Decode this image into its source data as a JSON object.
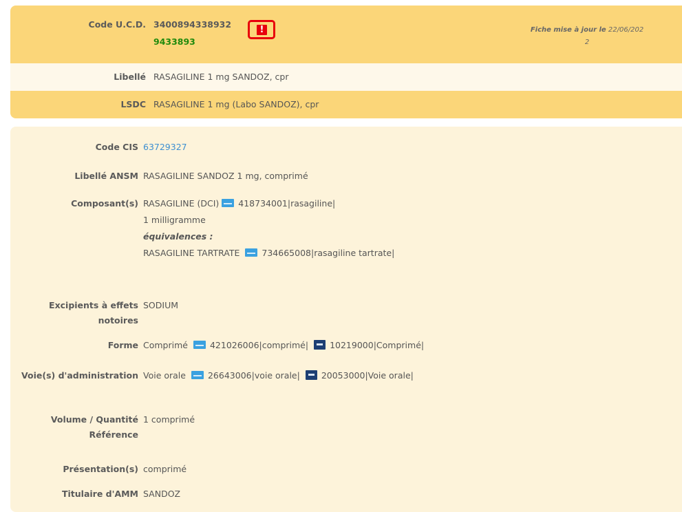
{
  "header": {
    "ucd_label": "Code U.C.D.",
    "ucd_value": "3400894338932",
    "ucd_sub": "9433893",
    "alert_icon": "!",
    "updated_label": "Fiche mise à jour le",
    "updated_date": "22/06/202",
    "updated_date_wrap": "2",
    "libelle_label": "Libellé",
    "libelle_value": "RASAGILINE 1 mg SANDOZ, cpr",
    "lsdc_label": "LSDC",
    "lsdc_value": "RASAGILINE 1 mg (Labo SANDOZ), cpr"
  },
  "details": {
    "cis_label": "Code CIS",
    "cis_value": "63729327",
    "ansm_label": "Libellé ANSM",
    "ansm_value": "RASAGILINE SANDOZ 1 mg, comprimé",
    "composant_label": "Composant(s)",
    "composant_name": "RASAGILINE (DCI)",
    "composant_code": "418734001|rasagiline|",
    "composant_dose": "1 milligramme",
    "equivalences_label": "équivalences :",
    "equiv_name": "RASAGILINE TARTRATE",
    "equiv_code": "734665008|rasagiline tartrate|",
    "excipients_label": "Excipients à effets notoires",
    "excipients_value": "SODIUM",
    "forme_label": "Forme",
    "forme_value": "Comprimé",
    "forme_code1": "421026006|comprimé|",
    "forme_code2": "10219000|Comprimé|",
    "voie_label": "Voie(s) d'administration",
    "voie_value": "Voie orale",
    "voie_code1": "26643006|voie orale|",
    "voie_code2": "20053000|Voie orale|",
    "volume_label": "Volume / Quantité Référence",
    "volume_value": "1 comprimé",
    "presentation_label": "Présentation(s)",
    "presentation_value": "comprimé",
    "titulaire_label": "Titulaire d'AMM",
    "titulaire_value": "SANDOZ"
  },
  "icons": {
    "alert": "alert-icon",
    "snomed": "snomed-ct-icon",
    "edqm": "edqm-icon"
  },
  "colors": {
    "header_bg": "#fbd679",
    "detail_bg": "#fdf3da",
    "alert_red": "#e8000b",
    "ucd_green": "#208a0c",
    "link_blue": "#3d8fd1"
  }
}
